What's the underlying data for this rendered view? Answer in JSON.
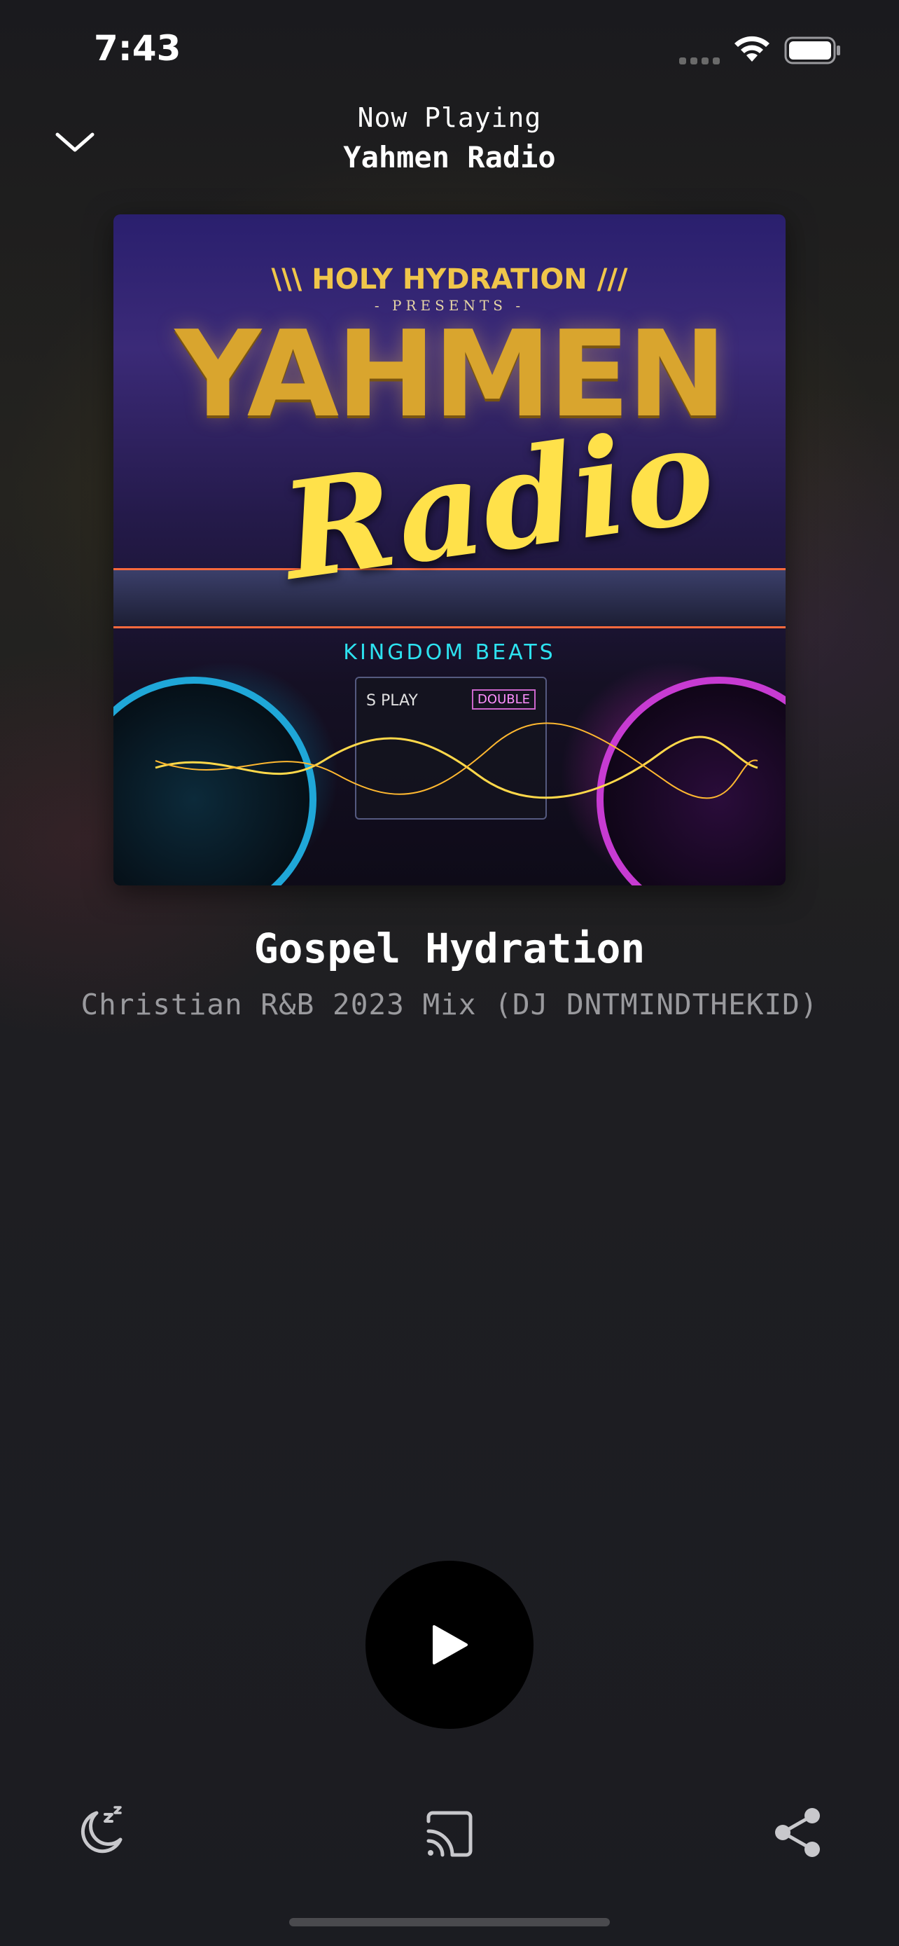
{
  "status_bar": {
    "time": "7:43",
    "icons": [
      "cellular-signal-icon",
      "wifi-icon",
      "battery-icon"
    ]
  },
  "header": {
    "collapse_icon": "chevron-down-icon",
    "subtitle": "Now Playing",
    "station": "Yahmen Radio"
  },
  "artwork": {
    "top_line": "\\\\\\ HOLY HYDRATION ///",
    "presents": "- PRESENTS -",
    "title": "YAHMEN",
    "script": "Radio",
    "sub": "KINGDOM BEATS",
    "deck_label": "S PLAY",
    "deck_badge": "DOUBLE"
  },
  "track": {
    "title": "Gospel Hydration",
    "subtitle": "Christian R&B 2023 Mix (DJ DNTMINDTHEKID)"
  },
  "controls": {
    "play_icon": "play-icon"
  },
  "bottom_bar": {
    "icons": [
      "sleep-timer-icon",
      "cast-icon",
      "share-icon"
    ]
  },
  "colors": {
    "background": "#1c1d22",
    "text_primary": "#ffffff",
    "text_secondary": "#9a9a9e",
    "play_button": "#000000",
    "icon": "#c8c8cc"
  }
}
